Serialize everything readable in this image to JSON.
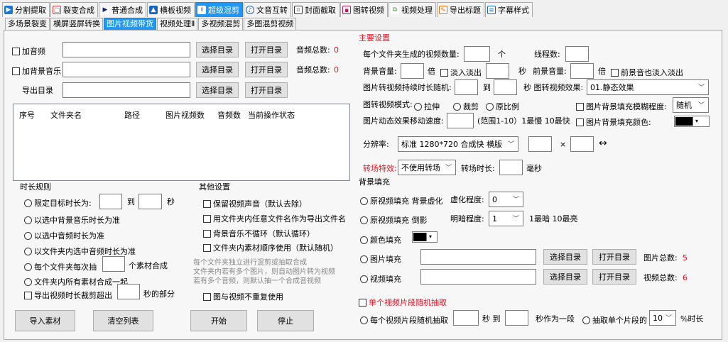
{
  "top_tabs": [
    {
      "label": "分割提取",
      "icon": "split-icon"
    },
    {
      "label": "裂变合成",
      "icon": "copy-icon"
    },
    {
      "label": "普通合成",
      "icon": "play-icon"
    },
    {
      "label": "横板视频",
      "icon": "landscape-icon"
    },
    {
      "label": "超级混剪",
      "icon": "audio-wave-icon",
      "active": true
    },
    {
      "label": "文音互转",
      "icon": "mic-icon"
    },
    {
      "label": "封面截取",
      "icon": "crop-icon"
    },
    {
      "label": "图转视频",
      "icon": "image-icon"
    },
    {
      "label": "视频处理",
      "icon": "video-process-icon"
    },
    {
      "label": "导出标题",
      "icon": "export-icon"
    },
    {
      "label": "字幕样式",
      "icon": "subtitle-icon"
    }
  ],
  "sub_tabs": [
    {
      "label": "多场景裂变"
    },
    {
      "label": "横屏竖屏转换"
    },
    {
      "label": "图片视频带货",
      "active": true
    },
    {
      "label": "视频处理Ⅱ"
    },
    {
      "label": "多视频混剪"
    },
    {
      "label": "多图混剪视频"
    }
  ],
  "left": {
    "add_audio": "加音频",
    "add_bgm": "加背景音乐",
    "export_dir": "导出目录",
    "select_dir": "选择目录",
    "open_dir": "打开目录",
    "audio_total": "音频总数:",
    "audio_total_value": "0",
    "bgm_total_value": "0",
    "table_headers": [
      "序号",
      "文件夹名",
      "路径",
      "图片视频数",
      "音频数",
      "当前操作状态"
    ]
  },
  "duration": {
    "title": "时长规则",
    "target_label": "限定目标时长为:",
    "to": "到",
    "sec": "秒",
    "opt_bgm": "以选中背景音乐时长为准",
    "opt_audio": "以选中音频时长为准",
    "opt_folder_audio": "以文件夹内选中音频时长为准",
    "opt_each_prefix": "每个文件夹每次抽",
    "opt_each_suffix": "个素材合成",
    "opt_all": "文件夹内所有素材合成一起",
    "trim_prefix": "导出视频时长裁剪超出",
    "trim_suffix": "秒的部分"
  },
  "other": {
    "title": "其他设置",
    "keep_sound": "保留视频声音（默认去除）",
    "use_name": "用文件夹内任意文件名作为导出文件名",
    "bgm_loop": "背景音乐不循环（默认循环）",
    "order": "文件夹内素材顺序使用（默认随机）",
    "hint1": "每个文件夹独立进行混剪或抽取合成",
    "hint2": "文件夹内若有多个图片，则自动图片转为视频",
    "hint3": "若有多个音频，则默认抽一个合成音视频",
    "no_repeat": "图与视频不重复使用"
  },
  "buttons": {
    "import": "导入素材",
    "clear": "清空列表",
    "start": "开始",
    "stop": "停止"
  },
  "main": {
    "title": "主要设置",
    "per_folder": "每个文件夹生成的视频数量:",
    "unit_ge": "个",
    "threads": "线程数:",
    "bg_volume": "背景音量:",
    "times": "倍",
    "fade": "淡入淡出",
    "sec": "秒",
    "fg_volume": "前景音量:",
    "fg_fade": "前景音也淡入淡出",
    "img_duration": "图片转视频持续时长随机:",
    "to": "到",
    "img_effect_label": "秒 图转视频效果:",
    "img_effect_value": "01.静态效果",
    "mode_label": "图转视频模式:",
    "mode_stretch": "拉伸",
    "mode_crop": "裁剪",
    "mode_ratio": "原比例",
    "blur_fill": "图片背景填充模糊程度:",
    "blur_value": "随机",
    "speed_label": "图片动态效果移动速度:",
    "speed_hint": "(范围1-10）1最慢 10最快",
    "bg_color_fill": "图片背景填充颜色:",
    "resolution_label": "分辨率:",
    "resolution_value": "标准 1280*720 合成快 横版",
    "times_sign": "×",
    "swap_sign": "↔",
    "transition_label": "转场特效:",
    "transition_value": "不使用转场",
    "transition_dur": "转场时长:",
    "ms": "毫秒",
    "bg_fill_title": "背景填充",
    "orig_blur": "原视频填充 背景虚化",
    "blur_degree": "虚化程度:",
    "blur_degree_value": "0",
    "orig_reflect": "原视频填充 倒影",
    "brightness": "明暗程度:",
    "brightness_value": "1",
    "brightness_hint": "1最暗 10最亮",
    "color_fill": "颜色填充",
    "img_fill": "图片填充",
    "video_fill": "视频填充",
    "select_dir": "选择目录",
    "open_dir": "打开目录",
    "img_total": "图片总数:",
    "img_total_value": "5",
    "video_total": "视频总数:",
    "video_total_value": "6",
    "random_clip_title": "单个视频片段随机抽取",
    "each_clip": "每个视频片段随机抽取",
    "sec_to": "秒 到",
    "as_segment": "秒作为一段",
    "extract_single": "抽取单个片段的",
    "pct_value": "10",
    "pct_suffix": "%时长"
  },
  "colors": {
    "accent": "#2196f3",
    "red": "#e81123"
  }
}
